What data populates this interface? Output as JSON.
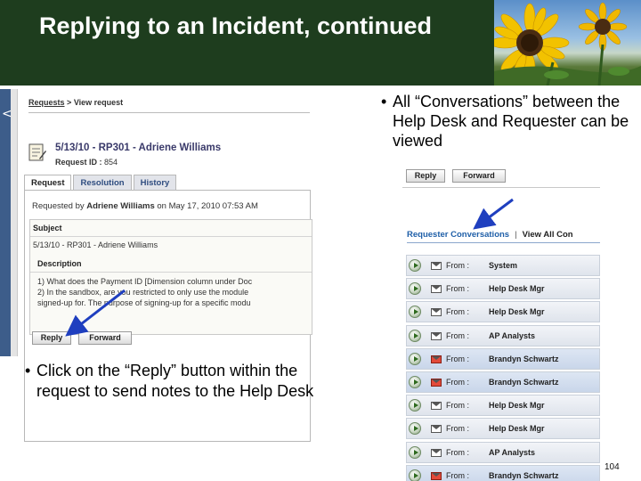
{
  "slide": {
    "title": "Replying to an Incident, continued",
    "page_number": "104"
  },
  "left_screenshot": {
    "rail_chevron": "<",
    "breadcrumb": {
      "link": "Requests",
      "separator": ">",
      "current": "View request"
    },
    "request_title": "5/13/10 - RP301 - Adriene Williams",
    "request_id_label": "Request ID :",
    "request_id_value": "854",
    "tabs": [
      {
        "label": "Request",
        "active": true
      },
      {
        "label": "Resolution",
        "active": false
      },
      {
        "label": "History",
        "active": false
      }
    ],
    "requested_by_prefix": "Requested by",
    "requested_by_name": "Adriene Williams",
    "requested_by_date": "on May 17, 2010 07:53 AM",
    "subject_label": "Subject",
    "subject_value": "5/13/10 - RP301 - Adriene Williams",
    "description_label": "Description",
    "description_lines": [
      "1)  What does the Payment ID [Dimension column under Doc",
      "2)  In the sandbox, are you restricted to only use the module",
      "signed-up for.  The purpose of signing-up for a specific modu"
    ],
    "reply_label": "Reply",
    "forward_label": "Forward"
  },
  "right_screenshot": {
    "reply_label": "Reply",
    "forward_label": "Forward",
    "conversations_title": "Requester Conversations",
    "separator": "|",
    "view_all_label": "View All Con",
    "rows": [
      {
        "from": "From :",
        "sender": "System",
        "icon": "mail-icon",
        "selected": false
      },
      {
        "from": "From :",
        "sender": "Help Desk Mgr",
        "icon": "mail-icon",
        "selected": false
      },
      {
        "from": "From :",
        "sender": "Help Desk Mgr",
        "icon": "mail-icon",
        "selected": false
      },
      {
        "from": "From :",
        "sender": "AP Analysts",
        "icon": "mail-icon",
        "selected": false
      },
      {
        "from": "From :",
        "sender": "Brandyn Schwartz",
        "icon": "urgent-mail-icon",
        "selected": true
      },
      {
        "from": "From :",
        "sender": "Brandyn Schwartz",
        "icon": "urgent-mail-icon",
        "selected": true
      },
      {
        "from": "From :",
        "sender": "Help Desk Mgr",
        "icon": "mail-icon",
        "selected": false
      },
      {
        "from": "From :",
        "sender": "Help Desk Mgr",
        "icon": "mail-icon",
        "selected": false
      },
      {
        "from": "From :",
        "sender": "AP Analysts",
        "icon": "mail-icon",
        "selected": false
      },
      {
        "from": "From :",
        "sender": "Brandyn Schwartz",
        "icon": "urgent-mail-icon",
        "selected": true
      }
    ]
  },
  "bullets": {
    "right": "All “Conversations” between the Help Desk and Requester can be viewed",
    "left": "Click on the “Reply” button within the request to send notes to the Help Desk",
    "marker": "•"
  },
  "colors": {
    "title_bar": "#1e3d1e",
    "link_blue": "#1f5fa8",
    "arrow_blue": "#1f3fbf"
  }
}
